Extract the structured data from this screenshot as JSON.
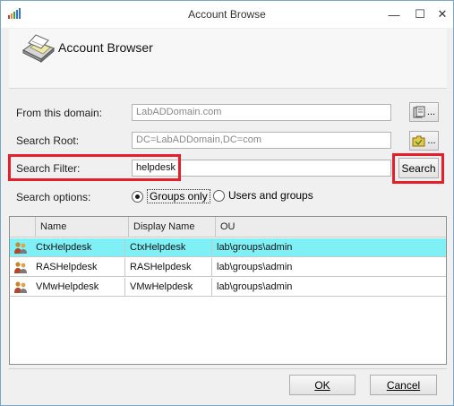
{
  "window": {
    "title": "Account Browse",
    "icon": "app-bars-icon",
    "controls": {
      "minimize": "—",
      "maximize": "☐",
      "close": "✕"
    }
  },
  "header": {
    "icon": "scanner-icon",
    "title": "Account Browser"
  },
  "form": {
    "domain_label": "From this domain:",
    "domain_value": "LabADDomain.com",
    "domain_button": "...",
    "root_label": "Search Root:",
    "root_value": "DC=LabADDomain,DC=com",
    "root_button": "...",
    "filter_label": "Search Filter:",
    "filter_value": "helpdesk",
    "search_button": "Search",
    "options_label": "Search options:",
    "option_groups": "Groups only",
    "option_users_groups": "Users and groups",
    "selected_option": "Groups only"
  },
  "grid": {
    "columns": [
      "Name",
      "Display Name",
      "OU"
    ],
    "rows": [
      {
        "name": "CtxHelpdesk",
        "display_name": "CtxHelpdesk",
        "ou": "lab\\groups\\admin",
        "selected": true
      },
      {
        "name": "RASHelpdesk",
        "display_name": "RASHelpdesk",
        "ou": "lab\\groups\\admin",
        "selected": false
      },
      {
        "name": "VMwHelpdesk",
        "display_name": "VMwHelpdesk",
        "ou": "lab\\groups\\admin",
        "selected": false
      }
    ]
  },
  "footer": {
    "ok_label": "OK",
    "cancel_label": "Cancel"
  },
  "colors": {
    "highlight": "#e5202a",
    "selected_row": "#7ff0f6",
    "window_border": "#7aa7c9"
  }
}
